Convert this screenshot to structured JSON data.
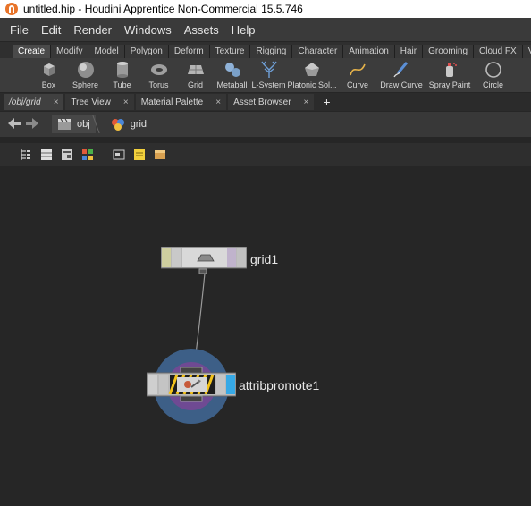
{
  "window": {
    "title": "untitled.hip - Houdini Apprentice Non-Commercial 15.5.746"
  },
  "menubar": {
    "items": [
      "File",
      "Edit",
      "Render",
      "Windows",
      "Assets",
      "Help"
    ]
  },
  "shelf_tabs": [
    "Create",
    "Modify",
    "Model",
    "Polygon",
    "Deform",
    "Texture",
    "Rigging",
    "Character",
    "Animation",
    "Hair",
    "Grooming",
    "Cloud FX",
    "Vo"
  ],
  "shelf_tools": [
    {
      "label": "Box",
      "icon": "box-icon"
    },
    {
      "label": "Sphere",
      "icon": "sphere-icon"
    },
    {
      "label": "Tube",
      "icon": "tube-icon"
    },
    {
      "label": "Torus",
      "icon": "torus-icon"
    },
    {
      "label": "Grid",
      "icon": "grid-icon"
    },
    {
      "label": "Metaball",
      "icon": "metaball-icon"
    },
    {
      "label": "L-System",
      "icon": "lsystem-icon"
    },
    {
      "label": "Platonic Sol...",
      "icon": "platonic-icon"
    },
    {
      "label": "Curve",
      "icon": "curve-icon"
    },
    {
      "label": "Draw Curve",
      "icon": "draw-curve-icon"
    },
    {
      "label": "Spray Paint",
      "icon": "spray-paint-icon"
    },
    {
      "label": "Circle",
      "icon": "circle-icon"
    }
  ],
  "pane_tabs": [
    {
      "label": "/obj/grid",
      "close": "×"
    },
    {
      "label": "Tree View",
      "close": "×"
    },
    {
      "label": "Material Palette",
      "close": "×"
    },
    {
      "label": "Asset Browser",
      "close": "×"
    }
  ],
  "add_tab": "+",
  "path": {
    "root": "obj",
    "current": "grid"
  },
  "nodes": {
    "grid": {
      "name": "grid1"
    },
    "attribpromote": {
      "name": "attribpromote1"
    }
  },
  "colors": {
    "accent": "#36a9e6",
    "halo_outer": "#3d5f87",
    "halo_inner": "#6f4a93"
  }
}
